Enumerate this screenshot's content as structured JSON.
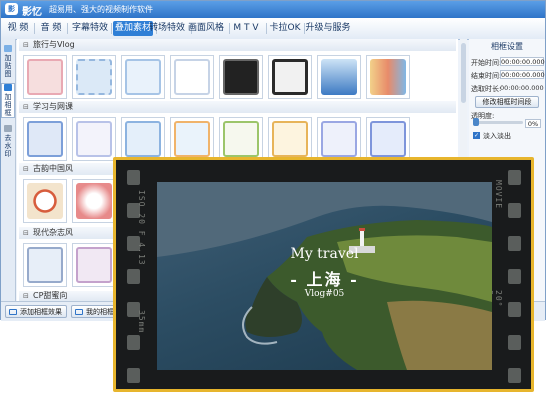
{
  "app": {
    "logo_text": "影",
    "name": "影忆",
    "slogan": "超易用、强大的视频制作软件"
  },
  "menu": {
    "tabs": [
      {
        "label": "视 频"
      },
      {
        "label": "音 频"
      },
      {
        "label": "字幕特效"
      },
      {
        "label": "叠加素材",
        "active": true
      },
      {
        "label": "转场特效"
      },
      {
        "label": "画面风格"
      },
      {
        "label": "M T V"
      },
      {
        "label": "卡拉OK"
      },
      {
        "label": "升级与服务"
      }
    ]
  },
  "sidebar": {
    "items": [
      {
        "label": "加贴图",
        "icon": "sticker-icon"
      },
      {
        "label": "加相框",
        "icon": "frame-icon",
        "active": true
      },
      {
        "label": "去水印",
        "icon": "watermark-icon"
      }
    ]
  },
  "categories": [
    {
      "label": "旅行与Vlog"
    },
    {
      "label": "学习与网课"
    },
    {
      "label": "古韵中国风"
    },
    {
      "label": "现代杂志风"
    },
    {
      "label": "CP甜蜜向"
    }
  ],
  "frame_settings": {
    "title": "相框设置",
    "start_label": "开始时间:",
    "start_value": "00:00:00.000",
    "end_label": "结束时间:",
    "end_value": "00:00:00.000",
    "duration_label": "选取时长:",
    "duration_value": "00:00:00.000",
    "modify_button": "修改相框时间段",
    "opacity_label": "透明度:",
    "opacity_value": "0%",
    "opacity_level": 0,
    "fade_label": "淡入淡出",
    "fade_checked": true
  },
  "bottom": {
    "add_button": "添加相框效果",
    "my_button": "我的相框"
  },
  "preview": {
    "line1": "My travel",
    "line2": "- 上海 -",
    "line3": "Vlog#05",
    "film_left": "ISO 20 F 4.13",
    "film_right_top": "MOVIE",
    "film_right_bottom": "20° 8",
    "film_left_bottom": "35mm"
  },
  "colors": {
    "accent": "#2f7fd6",
    "preview_border": "#e7b52d"
  }
}
